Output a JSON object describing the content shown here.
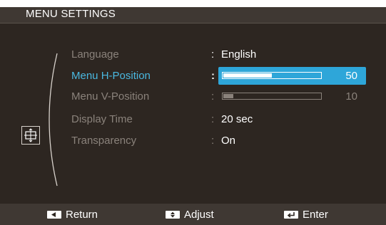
{
  "header": {
    "title": "MENU SETTINGS"
  },
  "menu": {
    "items": [
      {
        "label": "Language",
        "value": "English"
      },
      {
        "label": "Menu H-Position",
        "value": "50",
        "level": 0.5
      },
      {
        "label": "Menu V-Position",
        "value": "10",
        "level": 0.1
      },
      {
        "label": "Display Time",
        "value": "20 sec"
      },
      {
        "label": "Transparency",
        "value": "On"
      }
    ],
    "selected": "Menu H-Position"
  },
  "footer": {
    "return_label": "Return",
    "adjust_label": "Adjust",
    "enter_label": "Enter"
  },
  "colors": {
    "accent": "#2ea6d9",
    "background": "#2d2621",
    "selected_label": "#4ab8e0"
  },
  "icons": {
    "menu_icon": "osd-position-icon",
    "return_key": "left-arrow-key-icon",
    "adjust_key": "up-down-key-icon",
    "enter_key": "enter-key-icon"
  }
}
